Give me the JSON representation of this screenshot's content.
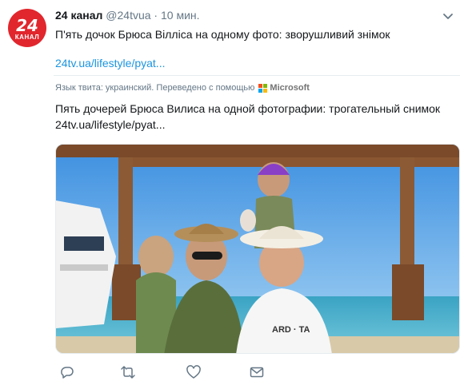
{
  "account": {
    "avatar_big": "24",
    "avatar_small": "КАНАЛ",
    "name": "24 канал",
    "handle": "@24tvua",
    "separator": "·",
    "time": "10 мин."
  },
  "tweet": {
    "text": "П'ять дочок Брюса Вілліса на одному фото: зворушливий знімок",
    "link": "24tv.ua/lifestyle/pyat..."
  },
  "translation": {
    "note": "Язык твита: украинский. Переведено с помощью",
    "provider": "Microsoft",
    "text": "Пять дочерей Брюса Вилиса на одной фотографии: трогательный снимок",
    "link": "24tv.ua/lifestyle/pyat..."
  },
  "icons": {
    "more": "chevron-down-icon",
    "reply": "reply-icon",
    "retweet": "retweet-icon",
    "like": "heart-icon",
    "dm": "envelope-icon"
  },
  "colors": {
    "brand": "#e1262d",
    "link": "#1b95e0",
    "muted": "#657786"
  }
}
